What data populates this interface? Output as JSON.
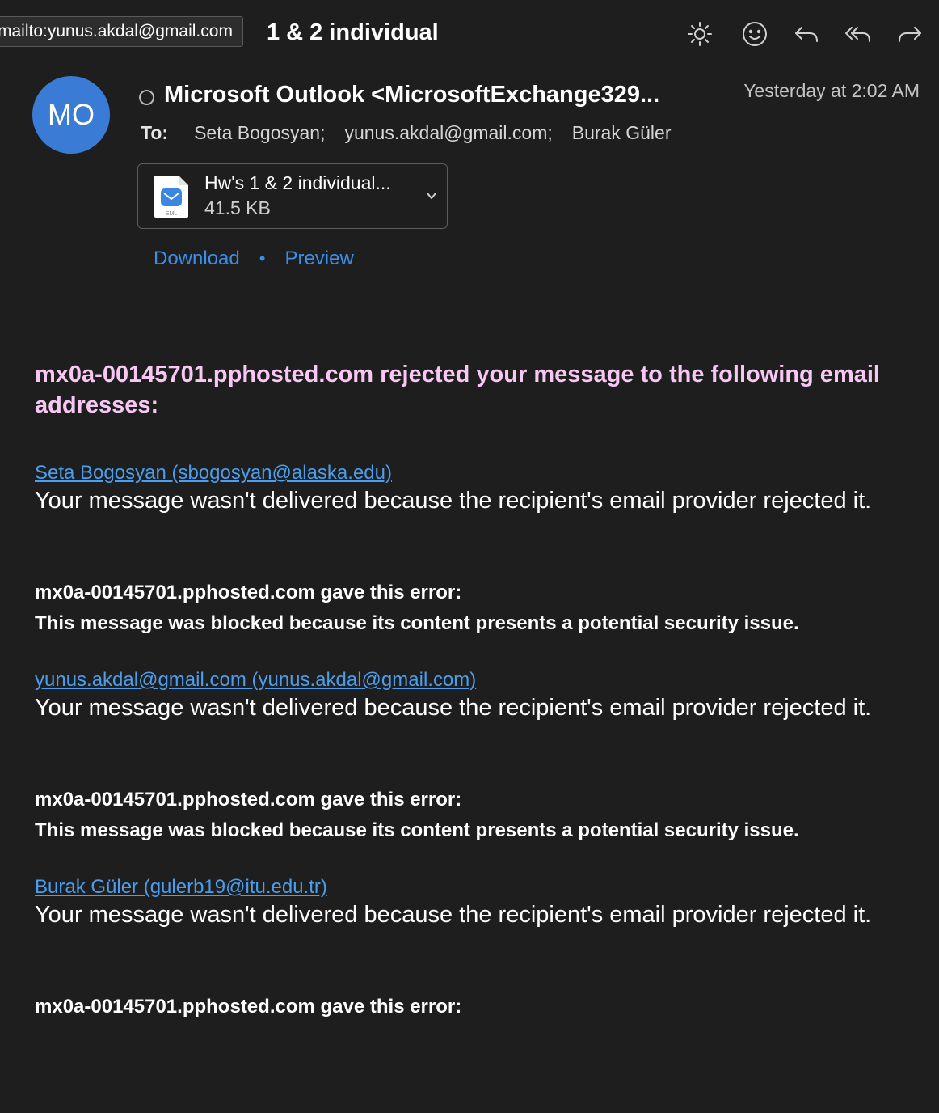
{
  "window": {
    "subject_fragment": "1 & 2 individual",
    "tooltip": "mailto:yunus.akdal@gmail.com",
    "toolbar_icons": [
      "brightness-icon",
      "emoji-icon",
      "reply-icon",
      "reply-all-icon",
      "forward-icon"
    ]
  },
  "message": {
    "avatar_initials": "MO",
    "sender": "Microsoft Outlook <MicrosoftExchange329...",
    "date": "Yesterday at 2:02 AM",
    "to_label": "To:",
    "recipients": [
      "Seta Bogosyan;",
      "yunus.akdal@gmail.com;",
      "Burak Güler"
    ]
  },
  "attachment": {
    "name": "Hw's 1 & 2 individual...",
    "size": "41.5 KB",
    "icon_label": "EML",
    "download_label": "Download",
    "separator": "•",
    "preview_label": "Preview"
  },
  "body": {
    "headline": "mx0a-00145701.pphosted.com rejected your message to the following email addresses:",
    "blocks": [
      {
        "recipient_link": "Seta Bogosyan (sbogosyan@alaska.edu)",
        "message": "Your message wasn't delivered because the recipient's email provider rejected it.",
        "error_title": "mx0a-00145701.pphosted.com gave this error:",
        "error_desc": "This message was blocked because its content presents a potential security issue."
      },
      {
        "recipient_link": "yunus.akdal@gmail.com (yunus.akdal@gmail.com)",
        "message": "Your message wasn't delivered because the recipient's email provider rejected it.",
        "error_title": "mx0a-00145701.pphosted.com gave this error:",
        "error_desc": "This message was blocked because its content presents a potential security issue."
      },
      {
        "recipient_link": "Burak Güler (gulerb19@itu.edu.tr)",
        "message": "Your message wasn't delivered because the recipient's email provider rejected it.",
        "error_title": "mx0a-00145701.pphosted.com gave this error:"
      }
    ]
  },
  "colors": {
    "background": "#1e1e1e",
    "avatar": "#3a7bd5",
    "link": "#4a9eec",
    "headline": "#f6c8f3"
  }
}
